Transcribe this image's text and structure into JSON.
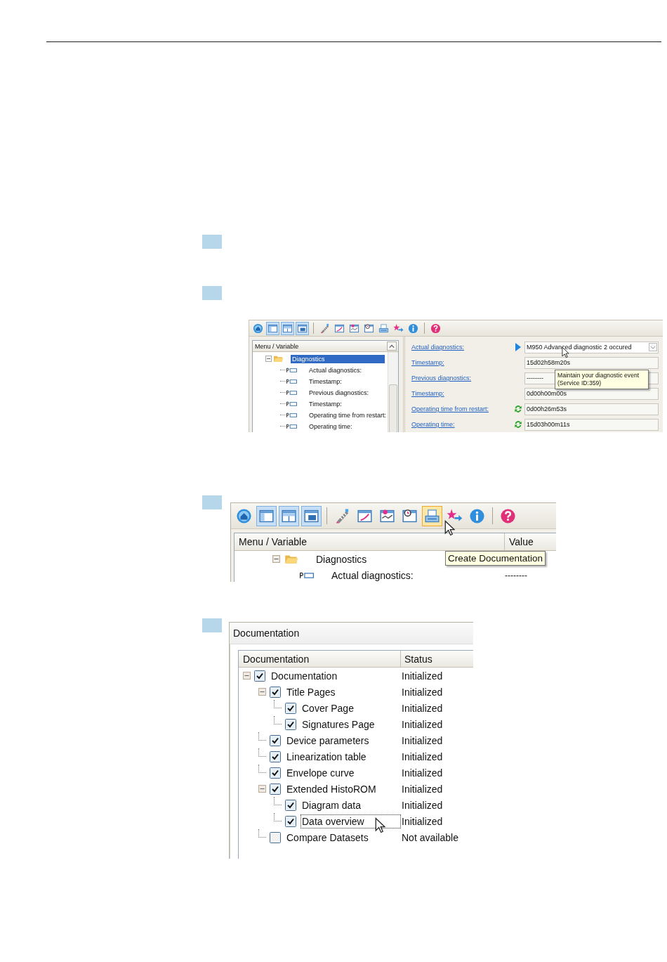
{
  "diagnostics_screen": {
    "toolbar": [
      [
        {
          "kind": "home",
          "pressed": false,
          "hovered": false
        },
        {
          "kind": "layout-a",
          "pressed": true,
          "hovered": false
        },
        {
          "kind": "layout-b",
          "pressed": true,
          "hovered": false
        },
        {
          "kind": "layout-c",
          "pressed": true,
          "hovered": false
        }
      ],
      [
        {
          "kind": "tool",
          "pressed": false,
          "hovered": false
        },
        {
          "kind": "curve",
          "pressed": false,
          "hovered": false
        },
        {
          "kind": "chart",
          "pressed": false,
          "hovered": false
        },
        {
          "kind": "clock",
          "pressed": false,
          "hovered": false
        },
        {
          "kind": "printer",
          "pressed": false,
          "hovered": false
        },
        {
          "kind": "arrows",
          "pressed": false,
          "hovered": false
        },
        {
          "kind": "info",
          "pressed": false,
          "hovered": false
        }
      ],
      [
        {
          "kind": "help",
          "pressed": false,
          "hovered": false
        }
      ]
    ],
    "tree_header": "Menu / Variable",
    "tree": [
      {
        "label": "Diagnostics",
        "expanded": true,
        "selected": true,
        "children": [
          {
            "label": "Actual diagnostics:",
            "selected": false
          },
          {
            "label": "Timestamp:",
            "selected": false
          },
          {
            "label": "Previous diagnostics:",
            "selected": false
          },
          {
            "label": "Timestamp:",
            "selected": false
          },
          {
            "label": "Operating time from restart:",
            "selected": false
          },
          {
            "label": "Operating time:",
            "selected": false
          }
        ]
      }
    ],
    "parameters": [
      {
        "label": "Actual diagnostics:",
        "kind": "select",
        "value": "M950 Advanced diagnostic 2 occured",
        "current": true,
        "refresh": false
      },
      {
        "label": "Timestamp:",
        "kind": "text",
        "value": "15d02h58m20s",
        "current": false,
        "refresh": false
      },
      {
        "label": "Previous diagnostics:",
        "kind": "text",
        "value": "--------",
        "current": false,
        "refresh": false
      },
      {
        "label": "Timestamp:",
        "kind": "text",
        "value": "0d00h00m00s",
        "current": false,
        "refresh": false
      },
      {
        "label": "Operating time from restart:",
        "kind": "text",
        "value": "0d00h26m53s",
        "current": false,
        "refresh": true
      },
      {
        "label": "Operating time:",
        "kind": "text",
        "value": "15d03h00m11s",
        "current": false,
        "refresh": true
      }
    ],
    "tooltip": [
      "Maintain your diagnostic event",
      "(Service ID:359)"
    ]
  },
  "toolbar_screen": {
    "toolbar": [
      [
        {
          "kind": "home",
          "pressed": false,
          "hovered": false
        },
        {
          "kind": "layout-a",
          "pressed": true,
          "hovered": false
        },
        {
          "kind": "layout-b",
          "pressed": true,
          "hovered": false
        },
        {
          "kind": "layout-c",
          "pressed": true,
          "hovered": false
        }
      ],
      [
        {
          "kind": "tool",
          "pressed": false,
          "hovered": false
        },
        {
          "kind": "curve",
          "pressed": false,
          "hovered": false
        },
        {
          "kind": "chart",
          "pressed": false,
          "hovered": false
        },
        {
          "kind": "clock",
          "pressed": false,
          "hovered": false
        },
        {
          "kind": "printer",
          "pressed": false,
          "hovered": true
        },
        {
          "kind": "arrows",
          "pressed": false,
          "hovered": false
        },
        {
          "kind": "info",
          "pressed": false,
          "hovered": false
        }
      ],
      [
        {
          "kind": "help",
          "pressed": false,
          "hovered": false
        }
      ]
    ],
    "columns": [
      "Menu / Variable",
      "Value"
    ],
    "rows": [
      {
        "kind": "folder",
        "label": "Diagnostics",
        "expanded": true
      },
      {
        "kind": "parameter",
        "label": "Actual diagnostics:",
        "value": "--------"
      }
    ],
    "tooltip": "Create Documentation"
  },
  "documentation_dialog": {
    "title": "Documentation",
    "columns": [
      "Documentation",
      "Status"
    ],
    "tree": [
      {
        "label": "Documentation",
        "status": "Initialized",
        "checked": true,
        "expanded": true,
        "selected": false,
        "children": [
          {
            "label": "Title Pages",
            "status": "Initialized",
            "checked": true,
            "expanded": true,
            "selected": false,
            "children": [
              {
                "label": "Cover Page",
                "status": "Initialized",
                "checked": true,
                "selected": false
              },
              {
                "label": "Signatures Page",
                "status": "Initialized",
                "checked": true,
                "selected": false
              }
            ]
          },
          {
            "label": "Device parameters",
            "status": "Initialized",
            "checked": true,
            "selected": false
          },
          {
            "label": "Linearization table",
            "status": "Initialized",
            "checked": true,
            "selected": false
          },
          {
            "label": "Envelope curve",
            "status": "Initialized",
            "checked": true,
            "selected": false
          },
          {
            "label": "Extended HistoROM",
            "status": "Initialized",
            "checked": true,
            "expanded": true,
            "selected": false,
            "children": [
              {
                "label": "Diagram data",
                "status": "Initialized",
                "checked": true,
                "selected": false
              },
              {
                "label": "Data overview",
                "status": "Initialized",
                "checked": true,
                "selected": true
              }
            ]
          },
          {
            "label": "Compare Datasets",
            "status": "Not available",
            "checked": false,
            "selected": false
          }
        ]
      }
    ]
  }
}
